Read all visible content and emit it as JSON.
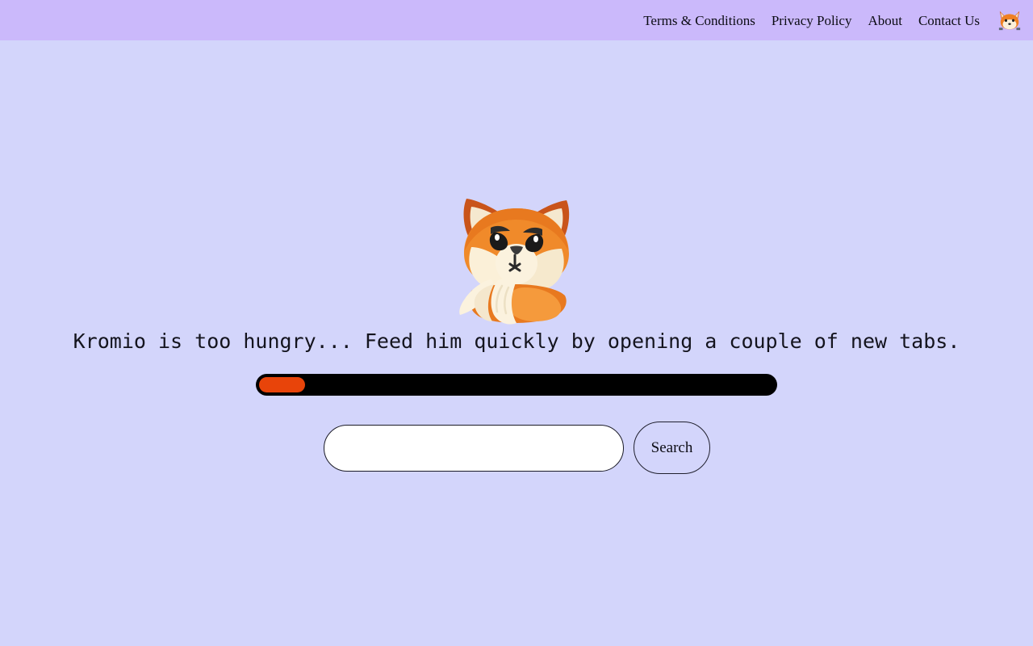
{
  "page": {
    "background_color": "#d3d5fb",
    "header_color": "#cbb9fb"
  },
  "header": {
    "nav_links": [
      {
        "label": "Terms & Conditions"
      },
      {
        "label": "Privacy Policy"
      },
      {
        "label": "About"
      },
      {
        "label": "Contact Us"
      }
    ],
    "brand_icon": "fox-icon"
  },
  "main": {
    "mascot_icon": "sad-fox-mascot",
    "message": "Kromio is too hungry... Feed him quickly by opening a couple of new tabs.",
    "progress": {
      "percent": 9,
      "track_color": "#000000",
      "fill_color": "#e8440a"
    },
    "search": {
      "input_value": "",
      "input_placeholder": "",
      "button_label": "Search"
    }
  }
}
